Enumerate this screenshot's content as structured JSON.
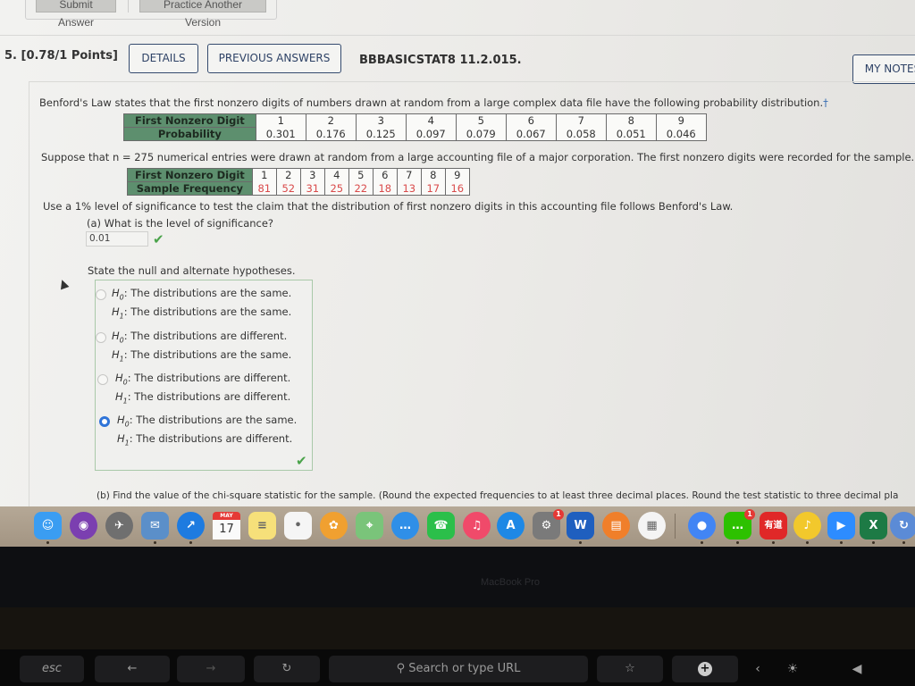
{
  "top_actions": {
    "submit_label": "Submit Answer",
    "practice_label": "Practice Another Version"
  },
  "question_header": {
    "number_points": "5.  [0.78/1 Points]",
    "details_label": "DETAILS",
    "previous_answers_label": "PREVIOUS ANSWERS",
    "code": "BBBASICSTAT8 11.2.015.",
    "my_notes_label": "MY NOTES"
  },
  "problem": {
    "intro": "Benford's Law states that the first nonzero digits of numbers drawn at random from a large complex data file have the following probability distribution.",
    "dagger": "†",
    "benford_table": {
      "row1_header": "First Nonzero Digit",
      "row2_header": "Probability",
      "digits": [
        "1",
        "2",
        "3",
        "4",
        "5",
        "6",
        "7",
        "8",
        "9"
      ],
      "probabilities": [
        "0.301",
        "0.176",
        "0.125",
        "0.097",
        "0.079",
        "0.067",
        "0.058",
        "0.051",
        "0.046"
      ]
    },
    "sample_sentence": "Suppose that n = 275 numerical entries were drawn at random from a large accounting file of a major corporation. The first nonzero digits were recorded for the sample.",
    "sample_table": {
      "row1_header": "First Nonzero Digit",
      "row2_header": "Sample Frequency",
      "digits": [
        "1",
        "2",
        "3",
        "4",
        "5",
        "6",
        "7",
        "8",
        "9"
      ],
      "frequencies": [
        "81",
        "52",
        "31",
        "25",
        "22",
        "18",
        "13",
        "17",
        "16"
      ]
    },
    "instruction": "Use a 1% level of significance to test the claim that the distribution of first nonzero digits in this accounting file follows Benford's Law."
  },
  "part_a": {
    "question": "(a) What is the level of significance?",
    "answer_value": "0.01",
    "correct_mark": "✔"
  },
  "hypotheses": {
    "prompt": "State the null and alternate hypotheses.",
    "h0_prefix": "H",
    "h0_sub": "0",
    "h1_prefix": "H",
    "h1_sub": "1",
    "options": [
      {
        "h0": ": The distributions are the same.",
        "h1": ": The distributions are the same.",
        "selected": false
      },
      {
        "h0": ": The distributions are different.",
        "h1": ": The distributions are the same.",
        "selected": false
      },
      {
        "h0": ": The distributions are different.",
        "h1": ": The distributions are different.",
        "selected": false
      },
      {
        "h0": ": The distributions are the same.",
        "h1": ": The distributions are different.",
        "selected": true
      }
    ],
    "correct_mark": "✔"
  },
  "part_b": {
    "question": "(b) Find the value of the chi-square statistic for the sample. (Round the expected frequencies to at least three decimal places. Round the test statistic to three decimal pla"
  },
  "dock": {
    "apps": [
      {
        "name": "Finder",
        "glyph": "☺",
        "color": "#3a9df2"
      },
      {
        "name": "Siri",
        "glyph": "◉",
        "color": "#7b3fb0"
      },
      {
        "name": "Launchpad",
        "glyph": "✈",
        "color": "#6f6f6f"
      },
      {
        "name": "Mail",
        "glyph": "✉",
        "color": "#5b8fc9"
      },
      {
        "name": "Safari",
        "glyph": "↗",
        "color": "#1e7be0"
      },
      {
        "name": "Calendar",
        "month": "MAY",
        "day": "17"
      },
      {
        "name": "Notes",
        "glyph": "≡",
        "color": "#f6e07a"
      },
      {
        "name": "Reminders",
        "glyph": "•",
        "color": "#f5f5f5"
      },
      {
        "name": "Photos",
        "glyph": "✿",
        "color": "#f0a030"
      },
      {
        "name": "Maps",
        "glyph": "⌖",
        "color": "#7ac47a"
      },
      {
        "name": "Messages",
        "glyph": "…",
        "color": "#2f8fe8"
      },
      {
        "name": "FaceTime",
        "glyph": "☎",
        "color": "#2bbf4a"
      },
      {
        "name": "Music",
        "glyph": "♫",
        "color": "#f04a6a"
      },
      {
        "name": "App Store",
        "glyph": "A",
        "color": "#1e88e5"
      },
      {
        "name": "System Preferences",
        "glyph": "⚙",
        "color": "#7a7a7a",
        "badge": "1"
      },
      {
        "name": "Word",
        "glyph": "W",
        "color": "#1f5fbf"
      },
      {
        "name": "Books",
        "glyph": "▤",
        "color": "#f07f2a"
      },
      {
        "name": "Microsoft AutoUpdate",
        "glyph": "▦",
        "color": "#f4f4f4"
      },
      {
        "name": "Chrome",
        "glyph": "●",
        "color": "#4285f4"
      },
      {
        "name": "WeChat",
        "glyph": "…",
        "color": "#2dc100",
        "badge": "1"
      },
      {
        "name": "Youdao",
        "glyph": "有道",
        "color": "#e02828"
      },
      {
        "name": "QQ Music",
        "glyph": "♪",
        "color": "#f2c82c"
      },
      {
        "name": "Zoom",
        "glyph": "▶",
        "color": "#2d8cff"
      },
      {
        "name": "Excel",
        "glyph": "X",
        "color": "#1d7a45"
      },
      {
        "name": "Network",
        "glyph": "↻",
        "color": "#5b8bd6"
      }
    ]
  },
  "bezel": {
    "label": "MacBook Pro"
  },
  "touchbar": {
    "esc_label": "esc",
    "back_glyph": "←",
    "forward_glyph": "→",
    "reload_glyph": "↻",
    "search_label": "Search or type URL",
    "search_glyph": "⚲",
    "bookmark_glyph": "☆",
    "newtab_glyph": "+",
    "collapse_glyph": "‹",
    "brightness_glyph": "☀",
    "volume_glyph": "◀"
  }
}
